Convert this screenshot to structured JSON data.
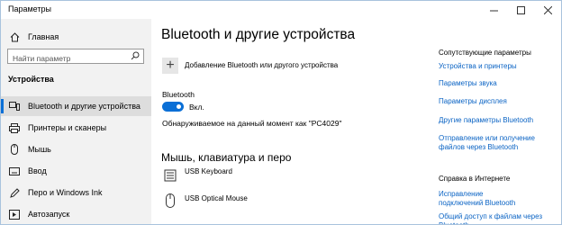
{
  "window": {
    "title": "Параметры"
  },
  "sidebar": {
    "home_label": "Главная",
    "search_placeholder": "Найти параметр",
    "section_label": "Устройства",
    "items": [
      {
        "label": "Bluetooth и другие устройства",
        "icon": "bluetooth-devices-icon"
      },
      {
        "label": "Принтеры и сканеры",
        "icon": "printer-icon"
      },
      {
        "label": "Мышь",
        "icon": "mouse-icon"
      },
      {
        "label": "Ввод",
        "icon": "keyboard-icon"
      },
      {
        "label": "Перо и Windows Ink",
        "icon": "pen-icon"
      },
      {
        "label": "Автозапуск",
        "icon": "autoplay-icon"
      }
    ]
  },
  "main": {
    "title": "Bluetooth и другие устройства",
    "add_device_label": "Добавление Bluetooth или другого устройства",
    "bluetooth_label": "Bluetooth",
    "toggle_state": "Вкл.",
    "discoverable_text": "Обнаруживаемое на данный момент как \"PC4029\"",
    "section_title": "Мышь, клавиатура и перо",
    "devices": [
      {
        "name": "USB Keyboard",
        "icon": "keyboard-device-icon"
      },
      {
        "name": "USB Optical Mouse",
        "icon": "mouse-device-icon"
      }
    ]
  },
  "related": {
    "heading": "Сопутствующие параметры",
    "links": [
      "Устройства и принтеры",
      "Параметры звука",
      "Параметры дисплея",
      "Другие параметры Bluetooth",
      "Отправление или получение файлов через Bluetooth"
    ]
  },
  "help": {
    "heading": "Справка в Интернете",
    "links": [
      "Исправление подключений Bluetooth",
      "Общий доступ к файлам через Bluetooth"
    ]
  },
  "colors": {
    "accent": "#0a6fd6",
    "link": "#0a63c4",
    "sidebar_bg": "#f2f2f2"
  }
}
